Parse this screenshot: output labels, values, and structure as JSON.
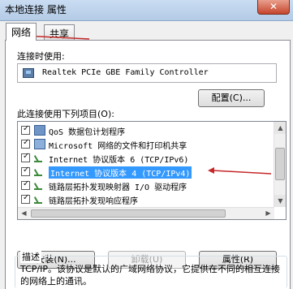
{
  "window": {
    "title": "本地连接 属性",
    "close_label": "✕"
  },
  "tabs": [
    {
      "label": "网络",
      "active": true
    },
    {
      "label": "共享",
      "active": false
    }
  ],
  "connect_using": {
    "label": "连接时使用:",
    "adapter": "Realtek PCIe GBE Family Controller",
    "configure_label": "配置(C)..."
  },
  "items_section": {
    "label": "此连接使用下列项目(O):",
    "items": [
      {
        "label": "QoS 数据包计划程序",
        "checked": true,
        "icon": "qos-icon"
      },
      {
        "label": "Microsoft 网络的文件和打印机共享",
        "checked": true,
        "icon": "network-service-icon"
      },
      {
        "label": "Internet 协议版本 6 (TCP/IPv6)",
        "checked": true,
        "icon": "protocol-icon"
      },
      {
        "label": "Internet 协议版本 4 (TCP/IPv4)",
        "checked": true,
        "icon": "protocol-icon",
        "selected": true
      },
      {
        "label": "链路层拓扑发现映射器 I/O 驱动程序",
        "checked": true,
        "icon": "protocol-icon"
      },
      {
        "label": "链路层拓扑发现响应程序",
        "checked": true,
        "icon": "protocol-icon"
      }
    ]
  },
  "buttons": {
    "install": "安装(N)...",
    "uninstall": "卸载(U)",
    "properties": "属性(R)"
  },
  "description": {
    "title": "描述",
    "text": "TCP/IP。该协议是默认的广域网络协议，它提供在不同的相互连接的网络上的通讯。"
  },
  "colors": {
    "annotation_arrow": "#c62828",
    "selection": "#3399ff"
  }
}
